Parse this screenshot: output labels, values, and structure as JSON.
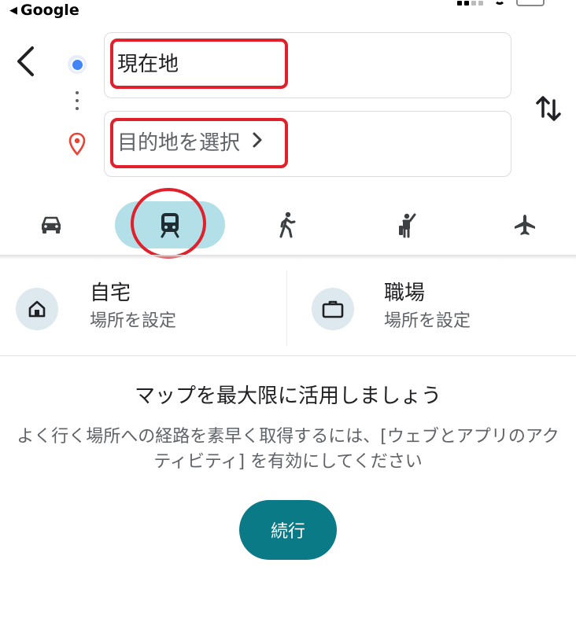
{
  "status_bar": {
    "back_app_label": "Google"
  },
  "directions": {
    "origin_value": "現在地",
    "destination_placeholder": "目的地を選択"
  },
  "modes": [
    {
      "icon": "car-icon",
      "selected": false
    },
    {
      "icon": "train-icon",
      "selected": true
    },
    {
      "icon": "walking-icon",
      "selected": false
    },
    {
      "icon": "ride-hailing-icon",
      "selected": false
    },
    {
      "icon": "airplane-icon",
      "selected": false
    }
  ],
  "saved_places": {
    "home": {
      "title": "自宅",
      "subtitle": "場所を設定"
    },
    "work": {
      "title": "職場",
      "subtitle": "場所を設定"
    }
  },
  "promo": {
    "title": "マップを最大限に活用しましょう",
    "body": "よく行く場所への経路を素早く取得するには、[ウェブとアプリのアクティビティ] を有効にしてください",
    "button_label": "続行"
  },
  "colors": {
    "accent": "#0b7a87",
    "selected_mode_bg": "#b2dfe8",
    "highlight_red": "#e0202a",
    "origin_blue": "#4285f4",
    "pin_red": "#ea4335"
  }
}
